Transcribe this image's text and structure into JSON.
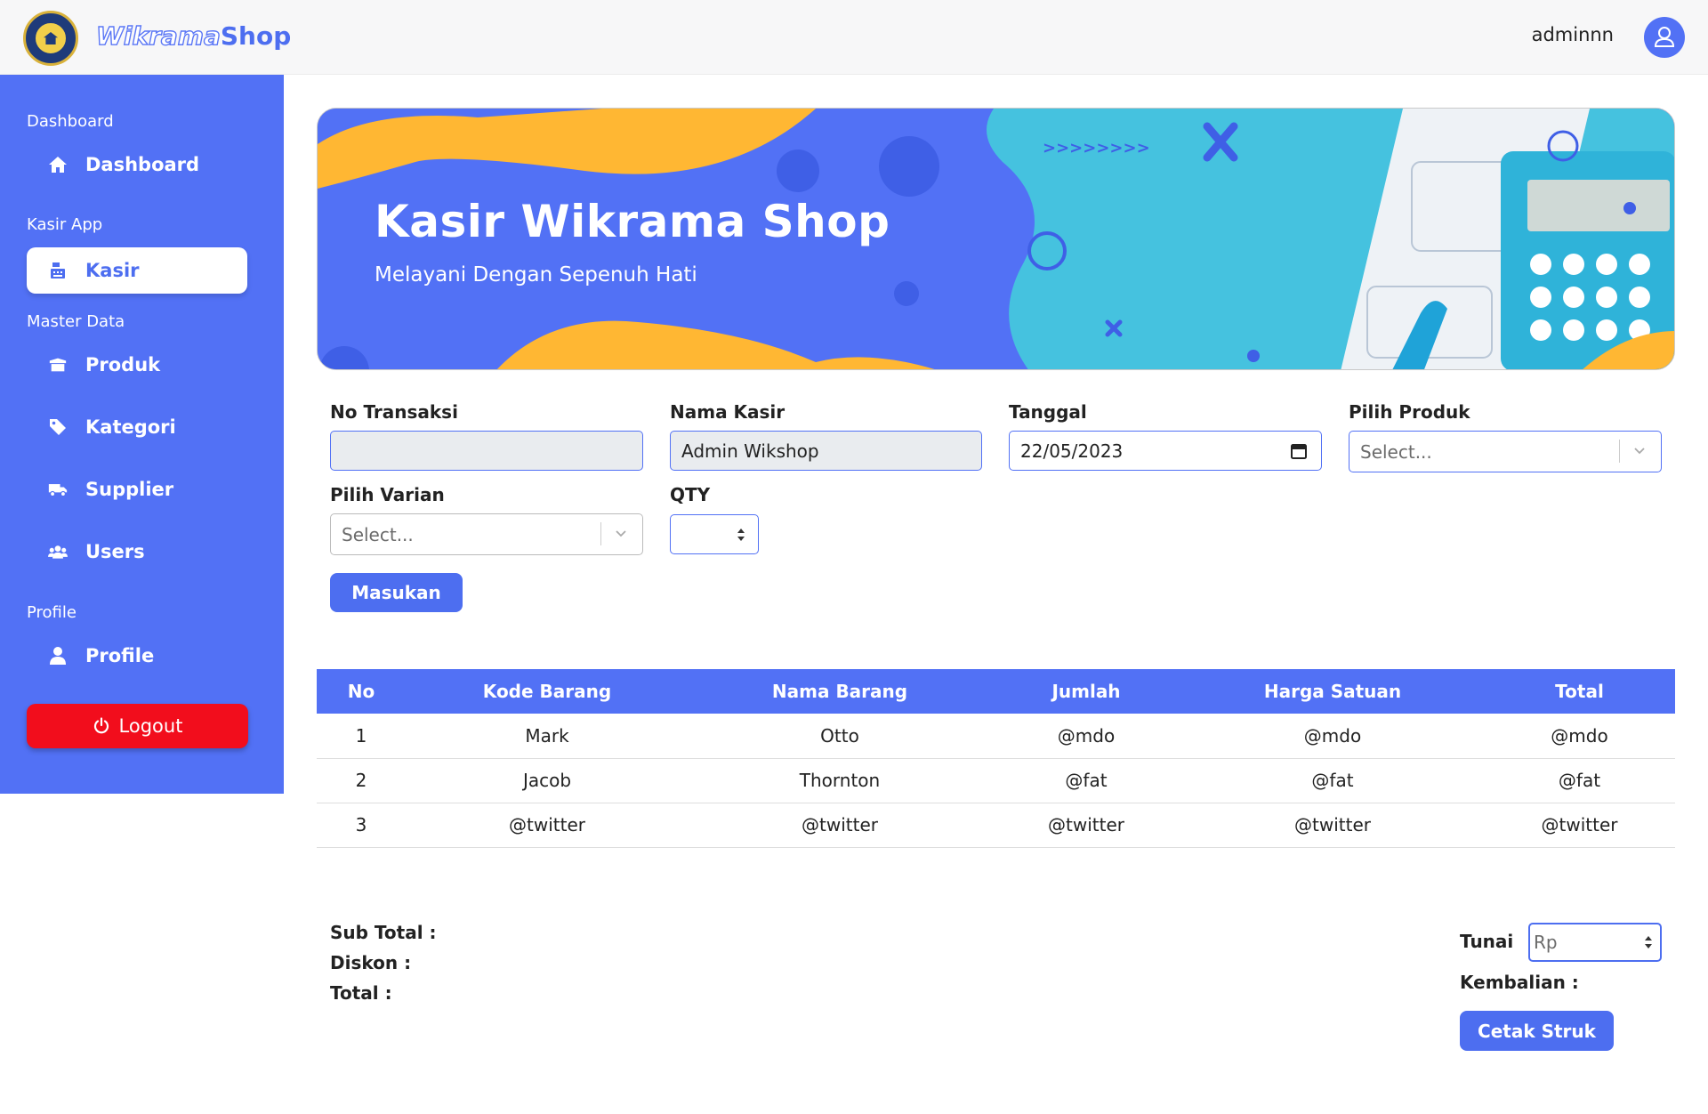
{
  "header": {
    "brand_part1": "Wikrama",
    "brand_part2": "Shop",
    "username": "adminnn",
    "avatar_icon": "user-icon",
    "logo_icon": "school-seal-logo"
  },
  "sidebar": {
    "sections": {
      "dashboard": "Dashboard",
      "kasir_app": "Kasir App",
      "master_data": "Master Data",
      "profile": "Profile"
    },
    "items": [
      {
        "label": "Dashboard",
        "icon": "home-icon"
      },
      {
        "label": "Kasir",
        "icon": "cash-register-icon"
      },
      {
        "label": "Produk",
        "icon": "box-icon"
      },
      {
        "label": "Kategori",
        "icon": "tags-icon"
      },
      {
        "label": "Supplier",
        "icon": "truck-icon"
      },
      {
        "label": "Users",
        "icon": "users-icon"
      },
      {
        "label": "Profile",
        "icon": "user-icon"
      }
    ],
    "logout_label": "Logout",
    "active_item": "Kasir",
    "accent_color": "#5271f5"
  },
  "banner": {
    "title": "Kasir Wikrama Shop",
    "subtitle": "Melayani Dengan Sepenuh Hati"
  },
  "form": {
    "no_transaksi": {
      "label": "No Transaksi",
      "value": ""
    },
    "nama_kasir": {
      "label": "Nama Kasir",
      "value": "Admin Wikshop"
    },
    "tanggal": {
      "label": "Tanggal",
      "value": "22/05/2023"
    },
    "pilih_produk": {
      "label": "Pilih Produk",
      "placeholder": "Select..."
    },
    "pilih_varian": {
      "label": "Pilih Varian",
      "placeholder": "Select..."
    },
    "qty": {
      "label": "QTY",
      "value": ""
    },
    "submit_label": "Masukan"
  },
  "table": {
    "headers": [
      "No",
      "Kode Barang",
      "Nama Barang",
      "Jumlah",
      "Harga Satuan",
      "Total"
    ],
    "rows": [
      [
        "1",
        "Mark",
        "Otto",
        "@mdo",
        "@mdo",
        "@mdo"
      ],
      [
        "2",
        "Jacob",
        "Thornton",
        "@fat",
        "@fat",
        "@fat"
      ],
      [
        "3",
        "@twitter",
        "@twitter",
        "@twitter",
        "@twitter",
        "@twitter"
      ]
    ]
  },
  "summary": {
    "sub_total": "Sub Total :",
    "diskon": "Diskon :",
    "total": "Total :",
    "tunai_label": "Tunai",
    "tunai_placeholder": "Rp",
    "kembalian": "Kembalian :",
    "print_label": "Cetak Struk"
  }
}
